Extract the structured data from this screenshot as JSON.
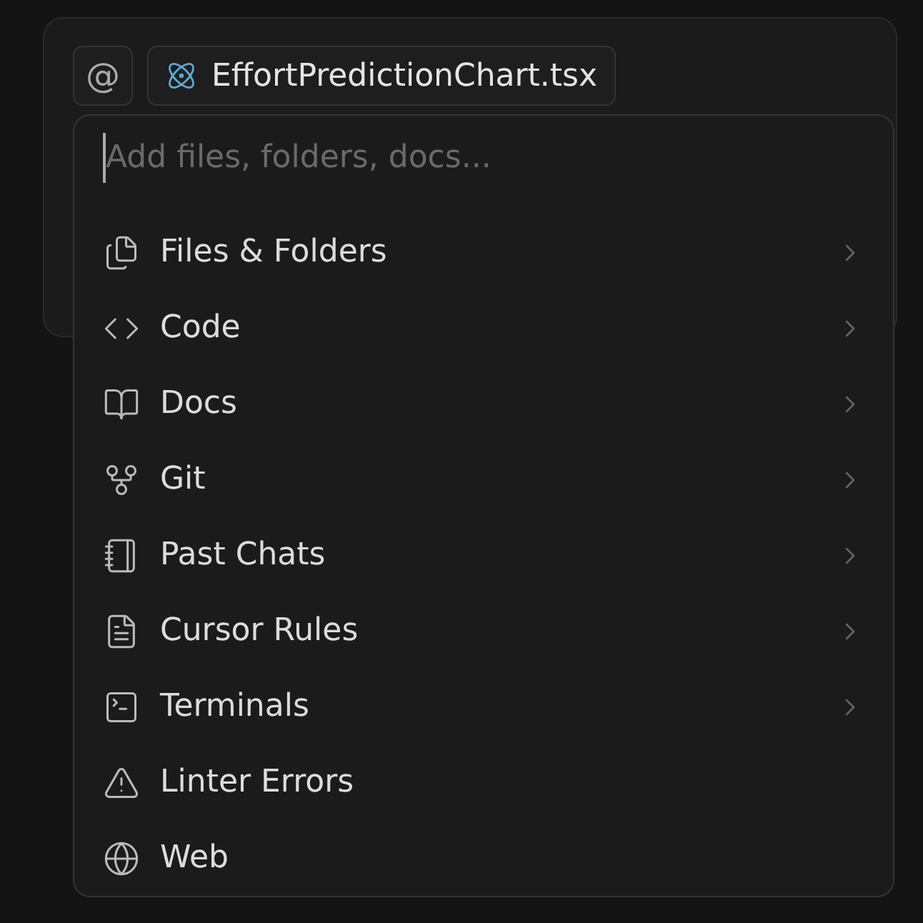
{
  "context_bar": {
    "at_button": "@",
    "file_chip": {
      "label": "EffortPredictionChart.tsx"
    }
  },
  "popup": {
    "search": {
      "placeholder": "Add files, folders, docs..."
    },
    "items": [
      {
        "label": "Files & Folders",
        "has_submenu": true
      },
      {
        "label": "Code",
        "has_submenu": true
      },
      {
        "label": "Docs",
        "has_submenu": true
      },
      {
        "label": "Git",
        "has_submenu": true
      },
      {
        "label": "Past Chats",
        "has_submenu": true
      },
      {
        "label": "Cursor Rules",
        "has_submenu": true
      },
      {
        "label": "Terminals",
        "has_submenu": true
      },
      {
        "label": "Linter Errors",
        "has_submenu": false
      },
      {
        "label": "Web",
        "has_submenu": false
      }
    ]
  }
}
